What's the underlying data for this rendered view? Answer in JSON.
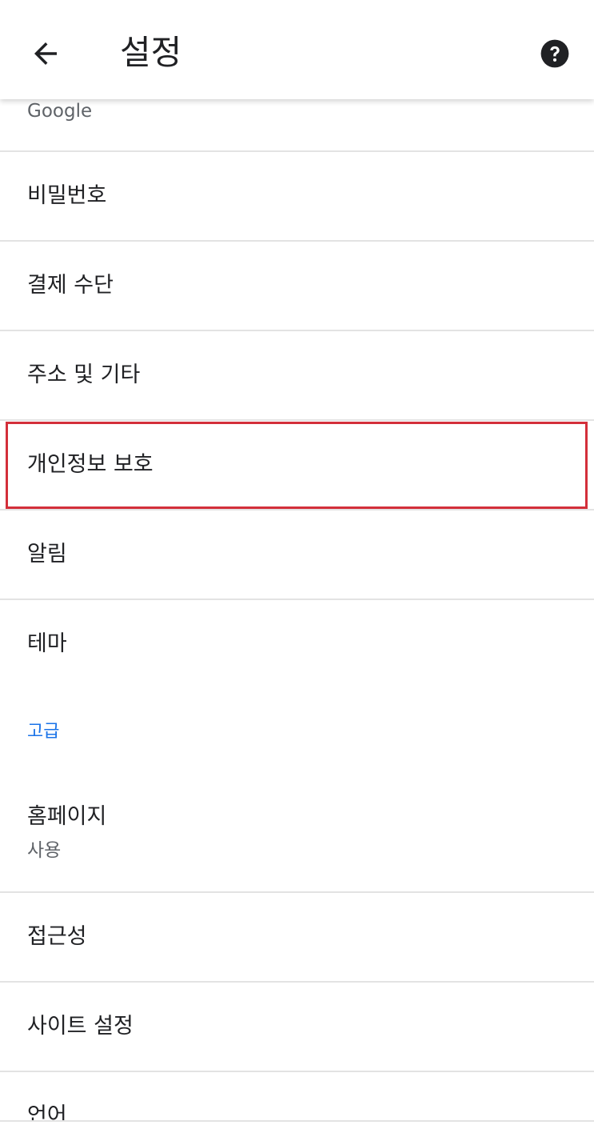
{
  "appbar": {
    "title": "설정",
    "back_icon": "arrow-back-icon",
    "help_icon": "help-circle-icon"
  },
  "rows": {
    "google_partial": "Google",
    "passwords": "비밀번호",
    "payment": "결제 수단",
    "addresses": "주소 및 기타",
    "privacy": "개인정보 보호",
    "notifications": "알림",
    "theme": "테마",
    "advanced_header": "고급",
    "homepage": "홈페이지",
    "homepage_sub": "사용",
    "accessibility": "접근성",
    "site_settings": "사이트 설정",
    "languages_partial": "언어"
  },
  "colors": {
    "accent": "#1a73e8",
    "highlight_border": "#d32f3a",
    "divider": "#e3e3e3"
  }
}
